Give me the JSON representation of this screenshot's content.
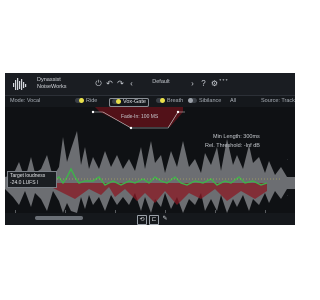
{
  "header": {
    "brand_line1": "Dynassist",
    "brand_line2": "NoiseWorks",
    "preset": "Default"
  },
  "mode_row": {
    "mode_label": "Mode: Vocal",
    "ride": "Ride",
    "voxgate": "Vox-Gate",
    "breath": "Breath",
    "sibilance": "Sibilance",
    "all": "All",
    "source": "Source: Track"
  },
  "main": {
    "fade_in": "Fade-In: 100 MS",
    "min_length": "Min Length: 300ms",
    "rel_threshold": "Rel. Threshold: -Inf dB",
    "target_label": "Target loudness",
    "target_value": "-24.0 LUFS I"
  },
  "colors": {
    "background": "#0f1114",
    "waveform": "#8a8c90",
    "green": "#3fb24a",
    "red": "#8a1a24",
    "accent_yellow": "#e9e04a"
  }
}
